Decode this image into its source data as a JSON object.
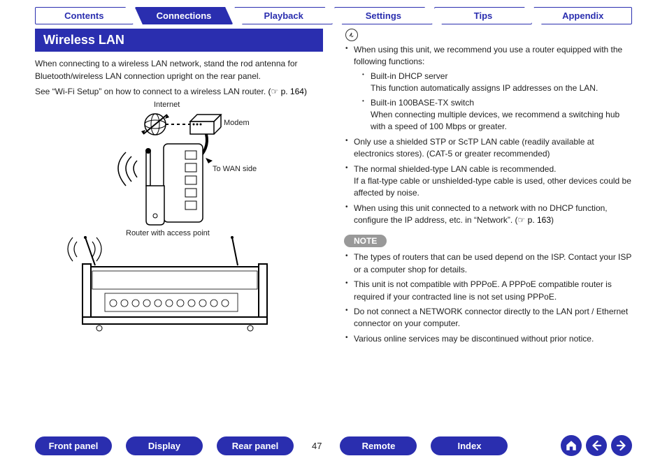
{
  "tabs": [
    {
      "label": "Contents",
      "active": false
    },
    {
      "label": "Connections",
      "active": true
    },
    {
      "label": "Playback",
      "active": false
    },
    {
      "label": "Settings",
      "active": false
    },
    {
      "label": "Tips",
      "active": false
    },
    {
      "label": "Appendix",
      "active": false
    }
  ],
  "section_title": "Wireless LAN",
  "intro": {
    "p1": "When connecting to a wireless LAN network, stand the rod antenna for Bluetooth/wireless LAN connection upright on the rear panel.",
    "p2": "See “Wi-Fi Setup” on how to connect to a wireless LAN router.",
    "p2_ref": "(☞ p. 164)"
  },
  "diagram_labels": {
    "internet": "Internet",
    "modem": "Modem",
    "wan": "To WAN side",
    "router": "Router with access point"
  },
  "right": {
    "tips": {
      "lead": "When using this unit, we recommend you use a router equipped with the following functions:",
      "sub1_title": "Built-in DHCP server",
      "sub1_body": "This function automatically assigns IP addresses on the LAN.",
      "sub2_title": "Built-in 100BASE-TX switch",
      "sub2_body": "When connecting multiple devices, we recommend a switching hub with a speed of 100 Mbps or greater.",
      "b2": "Only use a shielded STP or ScTP LAN cable (readily available at electronics stores). (CAT-5 or greater recommended)",
      "b3a": "The normal shielded-type LAN cable is recommended.",
      "b3b": "If a flat-type cable or unshielded-type cable is used, other devices could be affected by noise.",
      "b4a": "When using this unit connected to a network with no DHCP function, configure the IP address, etc. in “Network”.  (",
      "b4_ref": "☞ p. 163",
      "b4b": ")"
    },
    "note_label": "NOTE",
    "notes": {
      "n1": "The types of routers that can be used depend on the ISP. Contact your ISP or a computer shop for details.",
      "n2": "This unit is not compatible with PPPoE. A PPPoE compatible router is required if your contracted line is not set using PPPoE.",
      "n3": "Do not connect a NETWORK connector directly to the LAN port / Ethernet connector on your computer.",
      "n4": "Various online services may be discontinued without prior notice."
    }
  },
  "bottom_nav": {
    "b1": "Front panel",
    "b2": "Display",
    "b3": "Rear panel",
    "b4": "Remote",
    "b5": "Index"
  },
  "page_number": "47"
}
